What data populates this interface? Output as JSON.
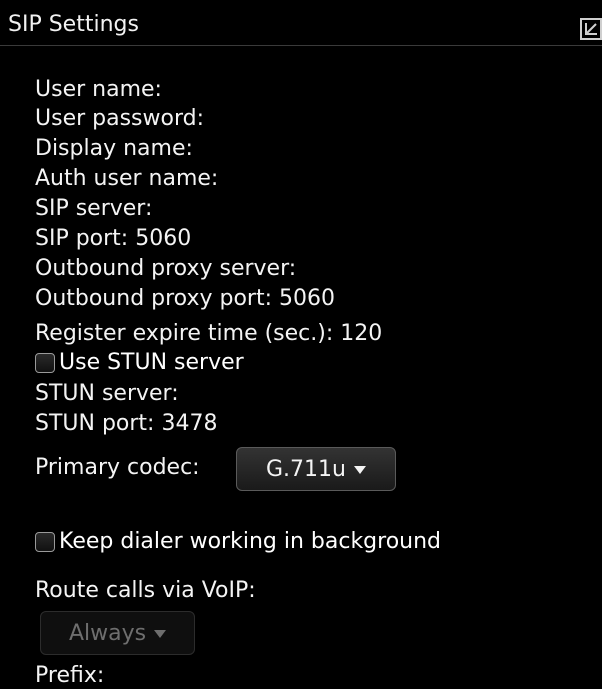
{
  "header": {
    "title": "SIP Settings",
    "corner_icon": "minimize-arrow-icon"
  },
  "fields": {
    "user_name": "User name:",
    "user_password": "User password:",
    "display_name": "Display name:",
    "auth_user_name": "Auth user name:",
    "sip_server": "SIP server:",
    "sip_port": "SIP port: 5060",
    "outbound_proxy_server": "Outbound proxy server:",
    "outbound_proxy_port": "Outbound proxy port: 5060",
    "register_expire": "Register expire time (sec.): 120",
    "use_stun_label": "Use STUN server",
    "use_stun_checked": false,
    "stun_server": "STUN server:",
    "stun_port": "STUN port: 3478",
    "primary_codec_label": "Primary codec:",
    "primary_codec_value": "G.711u",
    "keep_dialer_label": "Keep dialer working in background",
    "keep_dialer_checked": false,
    "route_calls_label": "Route calls via VoIP:",
    "route_calls_value": "Always",
    "prefix_label": "Prefix:"
  },
  "colors": {
    "background": "#000000",
    "text": "#f4f4f4",
    "disabled_text": "#6e6e6e"
  }
}
